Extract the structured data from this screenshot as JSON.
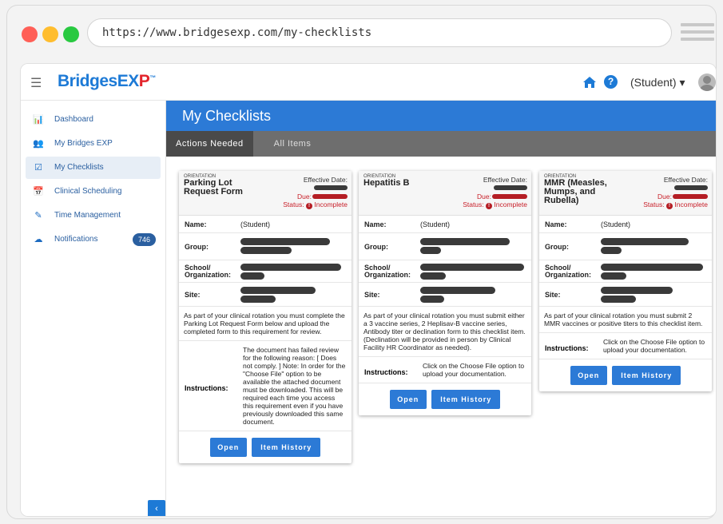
{
  "browser": {
    "url": "https://www.bridgesexp.com/my-checklists"
  },
  "header": {
    "logo_main": "Bridges",
    "logo_ex": "EX",
    "logo_p": "P",
    "logo_tm": "™",
    "user": "(Student) ▾",
    "help": "?"
  },
  "sidebar": {
    "items": [
      {
        "label": "Dashboard",
        "icon": "📊"
      },
      {
        "label": "My Bridges EXP",
        "icon": "👥"
      },
      {
        "label": "My Checklists",
        "icon": "☑"
      },
      {
        "label": "Clinical Scheduling",
        "icon": "📅"
      },
      {
        "label": "Time Management",
        "icon": "✎"
      },
      {
        "label": "Notifications",
        "icon": "☁",
        "badge": "746"
      }
    ],
    "collapse": "‹"
  },
  "main": {
    "title": "My Checklists",
    "tabs": [
      "Actions Needed",
      "All Items"
    ]
  },
  "cards": [
    {
      "category": "ORIENTATION",
      "title": "Parking Lot Request Form",
      "effective_label": "Effective Date:",
      "due_label": "Due:",
      "status_label": "Status:",
      "status_value": "Incomplete",
      "name_label": "Name:",
      "name_value": "(Student)",
      "group_label": "Group:",
      "school_label": "School/ Organization:",
      "site_label": "Site:",
      "description": "As part of your clinical rotation you must complete the Parking Lot Request Form below and upload the completed form to this requirement for review.",
      "instructions_label": "Instructions:",
      "instructions": "The document has failed review for the following reason: [ Does not comply. ] Note: In order for the \"Choose File\" option to be available the attached document must be downloaded. This will be required each time you access this requirement even if you have previously downloaded this same document.",
      "open": "Open",
      "history": "Item History"
    },
    {
      "category": "ORIENTATION",
      "title": "Hepatitis B",
      "effective_label": "Effective Date:",
      "due_label": "Due:",
      "status_label": "Status:",
      "status_value": "Incomplete",
      "name_label": "Name:",
      "name_value": "(Student)",
      "group_label": "Group:",
      "school_label": "School/ Organization:",
      "site_label": "Site:",
      "description": "As part of your clinical rotation you must submit either a 3 vaccine series, 2 Heplisav-B vaccine series, Antibody titer or declination form to this checklist item. (Declination will be provided in person by Clinical Facility HR Coordinator as needed).",
      "instructions_label": "Instructions:",
      "instructions": "Click on the Choose File option to upload your documentation.",
      "open": "Open",
      "history": "Item History"
    },
    {
      "category": "ORIENTATION",
      "title": "MMR (Measles, Mumps, and Rubella)",
      "effective_label": "Effective Date:",
      "due_label": "Due:",
      "status_label": "Status:",
      "status_value": "Incomplete",
      "name_label": "Name:",
      "name_value": "(Student)",
      "group_label": "Group:",
      "school_label": "School/ Organization:",
      "site_label": "Site:",
      "description": "As part of your clinical rotation you must submit 2 MMR vaccines or positive titers to this checklist item.",
      "instructions_label": "Instructions:",
      "instructions": "Click on the Choose File option to upload your documentation.",
      "open": "Open",
      "history": "Item History"
    }
  ]
}
